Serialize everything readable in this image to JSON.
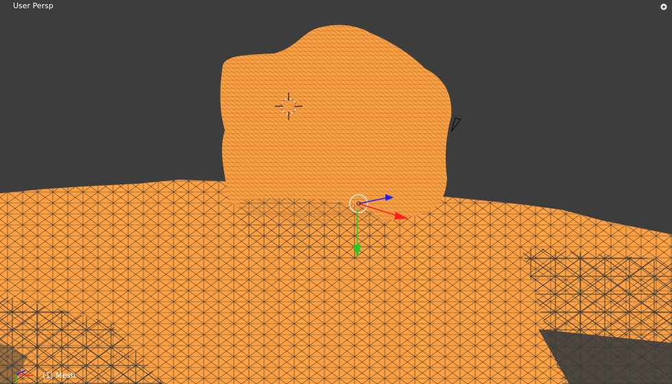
{
  "viewport": {
    "view_label": "User Persp",
    "object_label": "(1) Mesh"
  },
  "colors": {
    "background": "#3d3d3d",
    "mesh_selected": "#ffa040",
    "wire_dark": "#3d3d3d",
    "axis_x": "#ff2020",
    "axis_y": "#20cc20",
    "axis_z": "#2020ff",
    "text": "#ffffff"
  },
  "icons": {
    "corner": "zoom-plus-icon",
    "cursor": "3d-cursor-icon",
    "manipulator": "transform-manipulator-icon",
    "camera": "camera-icon",
    "axes": "axis-orientation-icon"
  }
}
